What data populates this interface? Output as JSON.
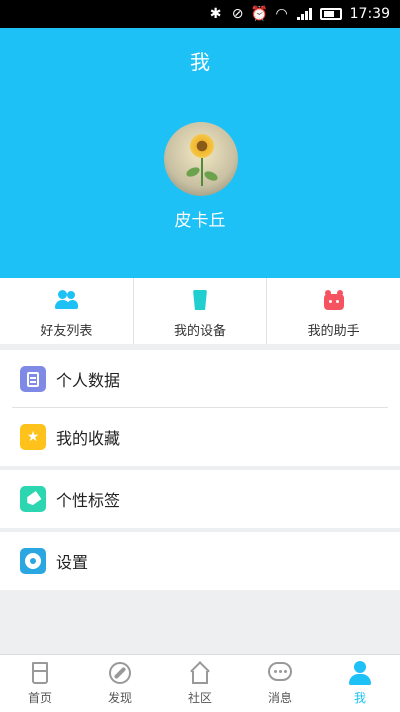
{
  "status_bar": {
    "time": "17:39",
    "icons": [
      "bluetooth-icon",
      "mute-icon",
      "alarm-icon",
      "wifi-icon",
      "signal-icon",
      "battery-icon"
    ]
  },
  "header": {
    "title": "我",
    "avatar": "sunflower-avatar",
    "username": "皮卡丘",
    "bg_color": "#1ec1f6"
  },
  "quick_actions": [
    {
      "label": "好友列表",
      "icon": "friends-icon",
      "color": "#1ec1f6"
    },
    {
      "label": "我的设备",
      "icon": "cup-icon",
      "color": "#22cfd0"
    },
    {
      "label": "我的助手",
      "icon": "assistant-icon",
      "color": "#f5535f"
    }
  ],
  "menu": [
    {
      "label": "个人数据",
      "icon": "document-icon",
      "color": "#7f8ae6"
    },
    {
      "label": "我的收藏",
      "icon": "star-icon",
      "color": "#ffc21a"
    },
    {
      "label": "个性标签",
      "icon": "tag-icon",
      "color": "#2cd6b0"
    },
    {
      "label": "设置",
      "icon": "gear-icon",
      "color": "#2aa6e0"
    }
  ],
  "bottom_nav": [
    {
      "label": "首页",
      "icon": "cup-outline-icon"
    },
    {
      "label": "发现",
      "icon": "compass-icon"
    },
    {
      "label": "社区",
      "icon": "house-icon"
    },
    {
      "label": "消息",
      "icon": "chat-bubble-icon"
    },
    {
      "label": "我",
      "icon": "person-icon",
      "active": true
    }
  ]
}
